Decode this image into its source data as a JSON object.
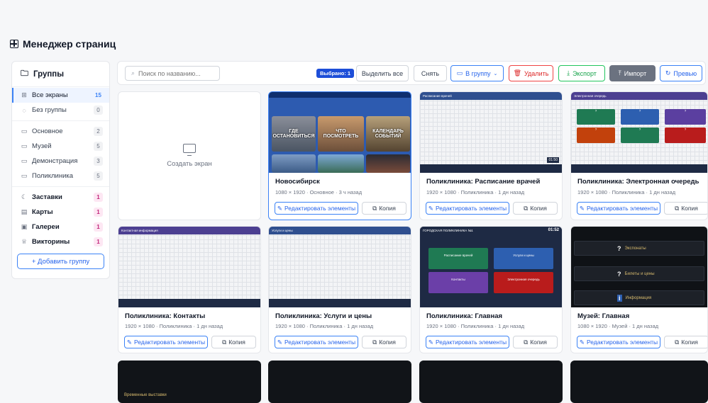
{
  "page": {
    "title": "Менеджер страниц"
  },
  "sidebar": {
    "header": "Группы",
    "items": [
      {
        "label": "Все экраны",
        "count": "15"
      },
      {
        "label": "Без группы",
        "count": "0"
      },
      {
        "label": "Основное",
        "count": "2"
      },
      {
        "label": "Музей",
        "count": "5"
      },
      {
        "label": "Демонстрация",
        "count": "3"
      },
      {
        "label": "Поликлиника",
        "count": "5"
      },
      {
        "label": "Заставки",
        "count": "1"
      },
      {
        "label": "Карты",
        "count": "1"
      },
      {
        "label": "Галереи",
        "count": "1"
      },
      {
        "label": "Викторины",
        "count": "1"
      }
    ],
    "add_group": "+ Добавить группу"
  },
  "toolbar": {
    "search_placeholder": "Поиск по названию...",
    "selected_badge": "Выбрано: 1",
    "select_all": "Выделить все",
    "unselect": "Снять",
    "to_group": "В группу",
    "delete": "Удалить",
    "export": "Экспорт",
    "import": "Импорт",
    "preview": "Превью"
  },
  "create_screen": "Создать экран",
  "card_actions": {
    "edit": "Редактировать элементы",
    "copy": "Копия"
  },
  "cards": [
    {
      "title": "Новосибирск",
      "meta": "1080 × 1920 · Основное · 3 ч назад"
    },
    {
      "title": "Поликлиника: Расписание врачей",
      "meta": "1920 × 1080 · Поликлиника · 1 дн назад"
    },
    {
      "title": "Поликлиника: Электронная очередь",
      "meta": "1920 × 1080 · Поликлиника · 1 дн назад"
    },
    {
      "title": "Поликлиника: Контакты",
      "meta": "1920 × 1080 · Поликлиника · 1 дн назад"
    },
    {
      "title": "Поликлиника: Услуги и цены",
      "meta": "1920 × 1080 · Поликлиника · 1 дн назад"
    },
    {
      "title": "Поликлиника: Главная",
      "meta": "1920 × 1080 · Поликлиника · 1 дн назад"
    },
    {
      "title": "Музей: Главная",
      "meta": "1080 × 1920 · Музей · 1 дн назад"
    }
  ],
  "thumbs": {
    "novosibirsk": [
      "ГДЕ ОСТАНОВИТЬСЯ",
      "ЧТО ПОСМОТРЕТЬ",
      "КАЛЕНДАРЬ СОБЫТИЙ"
    ],
    "schedule": {
      "header": "Расписание врачей",
      "time": "01:50"
    },
    "queue": {
      "header": "Электронная очередь"
    },
    "contacts": {
      "header": "Контактная информация"
    },
    "services": {
      "header": "Услуги и цены"
    },
    "main": {
      "header": "ГОРОДСКАЯ ПОЛИКЛИНИКА №1",
      "time": "01:52",
      "tiles": [
        "Расписание врачей",
        "Услуги и цены",
        "Контакты",
        "Электронная очередь"
      ]
    },
    "museum": [
      "Экспонаты",
      "Билеты и цены",
      "Информация"
    ],
    "row3_first": "Временные выставки"
  },
  "colors": {
    "accent": "#3b82f6",
    "danger": "#ef4444",
    "success": "#22c55e",
    "header_purple": "#4c3f91",
    "header_blue": "#2f4f8f"
  }
}
